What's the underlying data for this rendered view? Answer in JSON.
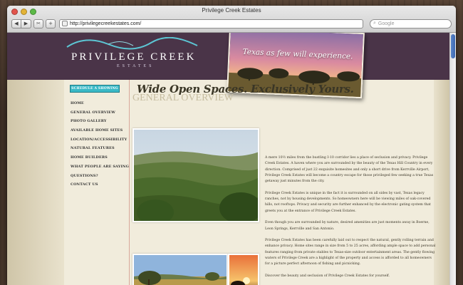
{
  "browser": {
    "window_title": "Privilege Creek Estates",
    "url": "http://privilegecreekestates.com/",
    "search_placeholder": "Google",
    "back_icon": "back-arrow-icon",
    "forward_icon": "forward-arrow-icon"
  },
  "site": {
    "logo_name": "PRIVILEGE CREEK",
    "logo_sub": "ESTATES",
    "hero_tagline": "Texas as few will experience.",
    "accent_color": "#3ab9c6",
    "header_color": "#4a3448"
  },
  "sidebar": {
    "schedule_button": "SCHEDULE A SHOWING",
    "nav": [
      "HOME",
      "GENERAL OVERVIEW",
      "PHOTO GALLERY",
      "AVAILABLE HOME SITES",
      "LOCATION/ACCESSIBILITY",
      "NATURAL FEATURES",
      "HOME BUILDERS",
      "WHAT PEOPLE ARE SAYING",
      "QUESTIONS?",
      "CONTACT US"
    ]
  },
  "main": {
    "tagline": "Wide Open Spaces. Exclusively Yours.",
    "section_title": "GENERAL OVERVIEW",
    "paragraphs": [
      "A mere 10½ miles from the bustling I-10 corridor lies a place of seclusion and privacy. Privilege Creek Estates. A haven where you are surrounded by the beauty of the Texas Hill Country in every direction. Comprised of just 22 exquisite homesites and only a short drive from Kerrville Airport, Privilege Creek Estates will become a country escape for those privileged few seeking a true Texas getaway just minutes from the city.",
      "Privilege Creek Estates is unique in the fact it is surrounded on all sides by vast, Texas legacy ranches, not by housing developments. So homeowners here will be viewing miles of oak-covered hills, not rooftops. Privacy and security are further enhanced by the electronic gating system that greets you at the entrance of Privilege Creek Estates.",
      "Even though you are surrounded by nature, desired amenities are just moments away in Boerne, Leon Springs, Kerrville and San Antonio.",
      "Privilege Creek Estates has been carefully laid out to respect the natural, gently rolling terrain and enhance privacy. Home sites range in size from 5 to 25 acres, affording ample space to add personal features ranging from private stables to Texas-size outdoor entertainment areas. The gently flowing waters of Privilege Creek are a highlight of the property and access is afforded to all homeowners for a picture perfect afternoon of fishing and picnicking.",
      "Discover the beauty and seclusion of Privilege Creek Estates for yourself."
    ]
  }
}
